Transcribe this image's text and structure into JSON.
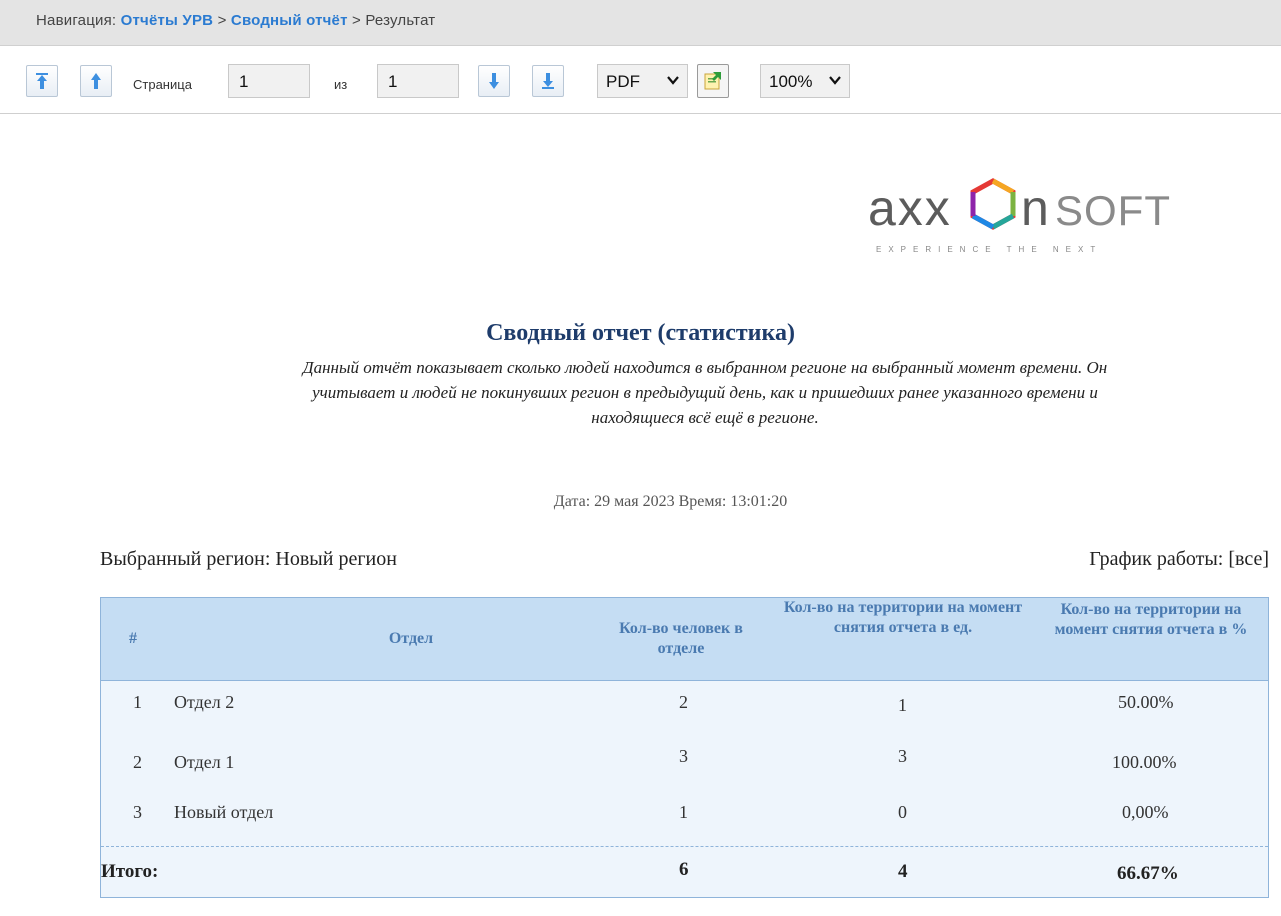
{
  "nav": {
    "prefix": "Навигация: ",
    "crumb1": "Отчёты УРВ",
    "sep1": " > ",
    "crumb2": "Сводный отчёт",
    "sep2": " > ",
    "current": "Результат"
  },
  "toolbar": {
    "page_label": "Страница",
    "page_value": "1",
    "of_label": "из",
    "total_pages": "1",
    "format_selected": "PDF",
    "zoom_selected": "100%"
  },
  "logo": {
    "text": "AxxonSoft",
    "tagline": "EXPERIENCE THE NEXT"
  },
  "report": {
    "title": "Сводный отчет (статистика)",
    "description": "Данный отчёт показывает сколько людей находится в выбранном регионе на выбранный момент времени. Он учитывает и людей не покинувших регион в предыдущий день, как и пришедших ранее указанного времени и находящиеся всё ещё в регионе.",
    "date_line": "Дата: 29 мая 2023 Время: 13:01:20",
    "region_line": "Выбранный регион: Новый регион",
    "schedule_line": "График работы: [все]"
  },
  "table": {
    "headers": [
      "#",
      "Отдел",
      "Кол-во человек в отделе",
      "Кол-во на территории на момент снятия отчета в ед.",
      "Кол-во на территории на момент снятия отчета в %"
    ],
    "rows": [
      [
        "1",
        "Отдел 2",
        "2",
        "1",
        "50.00%"
      ],
      [
        "2",
        "Отдел 1",
        "3",
        "3",
        "100.00%"
      ],
      [
        "3",
        "Новый отдел",
        "1",
        "0",
        "0,00%"
      ]
    ],
    "total": {
      "label": "Итого:",
      "people": "6",
      "present": "4",
      "percent": "66.67%"
    }
  },
  "colors": {
    "link": "#2b7bd1",
    "title": "#1e3c6b",
    "header_bg": "#c5ddf3",
    "header_text": "#4a7ab0",
    "table_bg": "#eef5fc"
  },
  "icons": [
    "first-page-icon",
    "prev-page-icon",
    "next-page-icon",
    "last-page-icon",
    "chevron-down-icon",
    "export-icon"
  ]
}
